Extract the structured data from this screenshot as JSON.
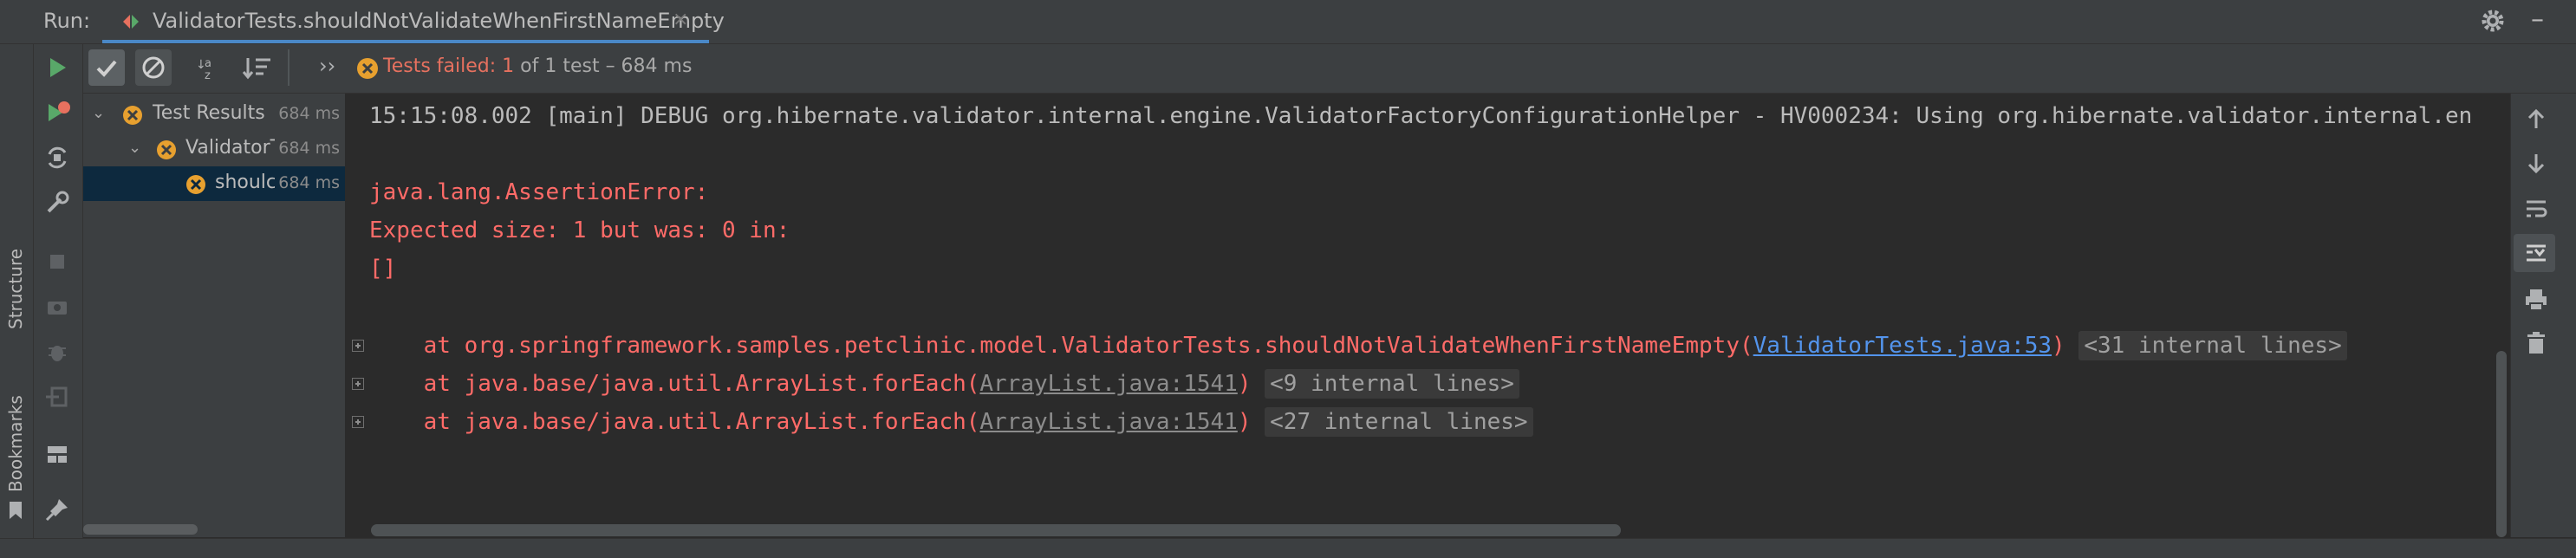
{
  "run_panel": {
    "label": "Run:",
    "tab_title": "ValidatorTests.shouldNotValidateWhenFirstNameEmpty",
    "tab_close": "×"
  },
  "side_labels": {
    "structure": "Structure",
    "bookmarks": "Bookmarks"
  },
  "status": {
    "failed_text": "Tests failed: 1",
    "rest_text": " of 1 test – 684 ms",
    "more_glyph": "››"
  },
  "tree": {
    "rows": [
      {
        "label": "Test Results",
        "duration": "684 ms",
        "status": "failed",
        "expanded": true
      },
      {
        "label": "ValidatorT",
        "duration": "684 ms",
        "status": "failed",
        "expanded": true
      },
      {
        "label": "shoulc",
        "duration": "684 ms",
        "status": "failed",
        "selected": true
      }
    ]
  },
  "console": {
    "debug_line": "15:15:08.002 [main] DEBUG org.hibernate.validator.internal.engine.ValidatorFactoryConfigurationHelper - HV000234: Using org.hibernate.validator.internal.en",
    "error_lines": [
      "java.lang.AssertionError:",
      "Expected size: 1 but was: 0 in:",
      "[]"
    ],
    "stack": [
      {
        "prefix": "    at org.springframework.samples.petclinic.model.ValidatorTests.shouldNotValidateWhenFirstNameEmpty(",
        "link": "ValidatorTests.java:53",
        "link_kind": "blue",
        "suffix": ")",
        "fold": "<31 internal lines>"
      },
      {
        "prefix": "    at java.base/java.util.ArrayList.forEach(",
        "link": "ArrayList.java:1541",
        "link_kind": "gray",
        "suffix": ")",
        "fold": "<9 internal lines>"
      },
      {
        "prefix": "    at java.base/java.util.ArrayList.forEach(",
        "link": "ArrayList.java:1541",
        "link_kind": "gray",
        "suffix": ")",
        "fold": "<27 internal lines>"
      }
    ]
  },
  "colors": {
    "accent": "#4a88c7",
    "run_green": "#59a869",
    "failed_orange": "#e7a02f",
    "error_red": "#ff6b68",
    "link_blue": "#5394ec"
  },
  "icons": {
    "run": "play-icon",
    "rerun_failed": "rerun-failed-icon",
    "toggle_auto_test": "auto-test-icon",
    "settings": "wrench-icon",
    "stop": "stop-icon",
    "snapshot": "camera-icon",
    "debug": "bug-icon",
    "import": "import-icon",
    "layout": "layout-icon",
    "pin": "pin-icon",
    "show_passed": "check-icon",
    "show_ignored": "ignored-icon",
    "sort_alpha": "sort-alpha-icon",
    "sort_duration": "sort-duration-icon",
    "scroll_up": "arrow-up-icon",
    "scroll_down": "arrow-down-icon",
    "soft_wrap": "soft-wrap-icon",
    "scroll_end": "scroll-to-end-icon",
    "print": "print-icon",
    "clear": "trash-icon"
  }
}
